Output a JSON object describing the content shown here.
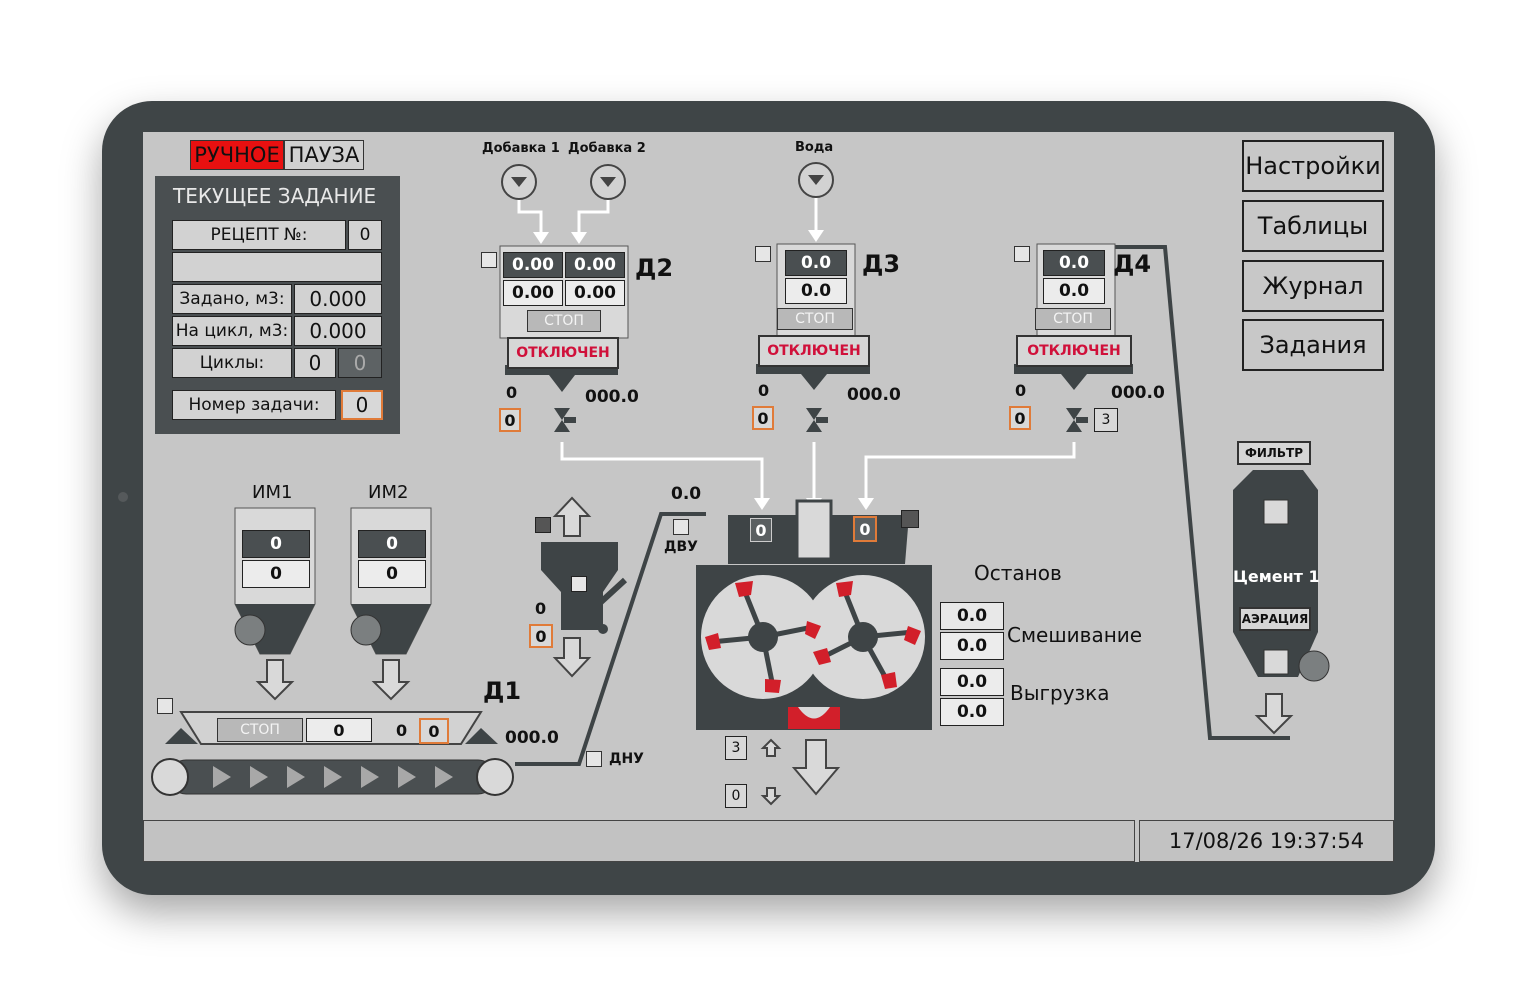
{
  "mode": {
    "manual": "РУЧНОЕ",
    "pause": "ПАУЗА"
  },
  "task": {
    "title": "ТЕКУЩЕЕ ЗАДАНИЕ",
    "recipe_label": "РЕЦЕПТ №:",
    "recipe_value": "0",
    "recipe_name": "",
    "set_label": "Задано, м3:",
    "set_value": "0.000",
    "cycle_label": "На цикл, м3:",
    "cycle_value": "0.000",
    "cycles_label": "Циклы:",
    "cycles_value": "0",
    "cycles_done": "0",
    "task_no_label": "Номер задачи:",
    "task_no_value": "0"
  },
  "menu": [
    "Настройки",
    "Таблицы",
    "Журнал",
    "Задания"
  ],
  "inputs": {
    "add1": "Добавка 1",
    "add2": "Добавка 2",
    "water": "Вода"
  },
  "d2": {
    "name": "Д2",
    "r1": [
      "0.00",
      "0.00"
    ],
    "r2": [
      "0.00",
      "0.00"
    ],
    "stop": "СТОП",
    "state": "ОТКЛЮЧЕН",
    "left_val": "0",
    "left_box": "0",
    "weight": "000.0"
  },
  "d3": {
    "name": "Д3",
    "r1": "0.0",
    "r2": "0.0",
    "stop": "СТОП",
    "state": "ОТКЛЮЧЕН",
    "left_val": "0",
    "left_box": "0",
    "weight": "000.0"
  },
  "d4": {
    "name": "Д4",
    "r1": "0.0",
    "r2": "0.0",
    "stop": "СТОП",
    "state": "ОТКЛЮЧЕН",
    "left_val": "0",
    "left_box": "0",
    "weight": "000.0",
    "valve_box": "3"
  },
  "im1": {
    "name": "ИМ1",
    "v1": "0",
    "v2": "0"
  },
  "im2": {
    "name": "ИМ2",
    "v1": "0",
    "v2": "0"
  },
  "d1": {
    "name": "Д1",
    "stop": "СТОП",
    "value": "0",
    "small": "0",
    "box": "0",
    "weight": "000.0"
  },
  "skip": {
    "top_val": "0.0",
    "dvu": "ДВУ",
    "dnu": "ДНУ",
    "val": "0",
    "box": "0"
  },
  "mixer": {
    "in_left": "0",
    "in_right": "0",
    "status": "Останов",
    "mix_label": "Смешивание",
    "mix_v1": "0.0",
    "mix_v2": "0.0",
    "unload_label": "Выгрузка",
    "unload_v1": "0.0",
    "unload_v2": "0.0",
    "gate_up_box": "3",
    "gate_down_box": "0"
  },
  "silo": {
    "filter": "ФИЛЬТР",
    "name": "Цемент 1",
    "aeration": "АЭРАЦИЯ"
  },
  "status_bar": {
    "message": "",
    "datetime": "17/08/26 19:37:54"
  },
  "colors": {
    "bezel": "#3f4547",
    "screen": "#c6c6c6",
    "equipment": "#4a4f51",
    "alarm": "#d0103a",
    "manual_bg": "#e81010",
    "accent_orange": "#e07b39"
  }
}
